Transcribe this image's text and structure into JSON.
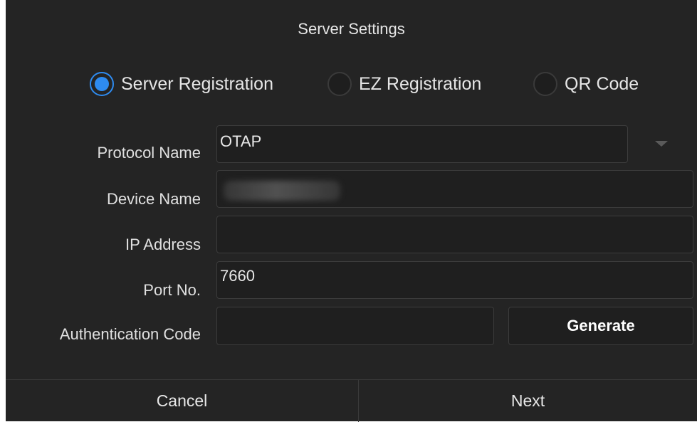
{
  "dialog": {
    "title": "Server Settings"
  },
  "registration_modes": [
    {
      "label": "Server Registration",
      "selected": true
    },
    {
      "label": "EZ Registration",
      "selected": false
    },
    {
      "label": "QR Code",
      "selected": false
    }
  ],
  "form": {
    "protocol_name": {
      "label": "Protocol Name",
      "value": "OTAP"
    },
    "device_name": {
      "label": "Device Name",
      "value": ""
    },
    "ip_address": {
      "label": "IP Address",
      "value": ""
    },
    "port_no": {
      "label": "Port No.",
      "value": "7660"
    },
    "authentication_code": {
      "label": "Authentication Code",
      "value": ""
    },
    "generate_label": "Generate"
  },
  "footer": {
    "cancel_label": "Cancel",
    "next_label": "Next"
  },
  "colors": {
    "background": "#242424",
    "accent": "#2e8bf0"
  }
}
